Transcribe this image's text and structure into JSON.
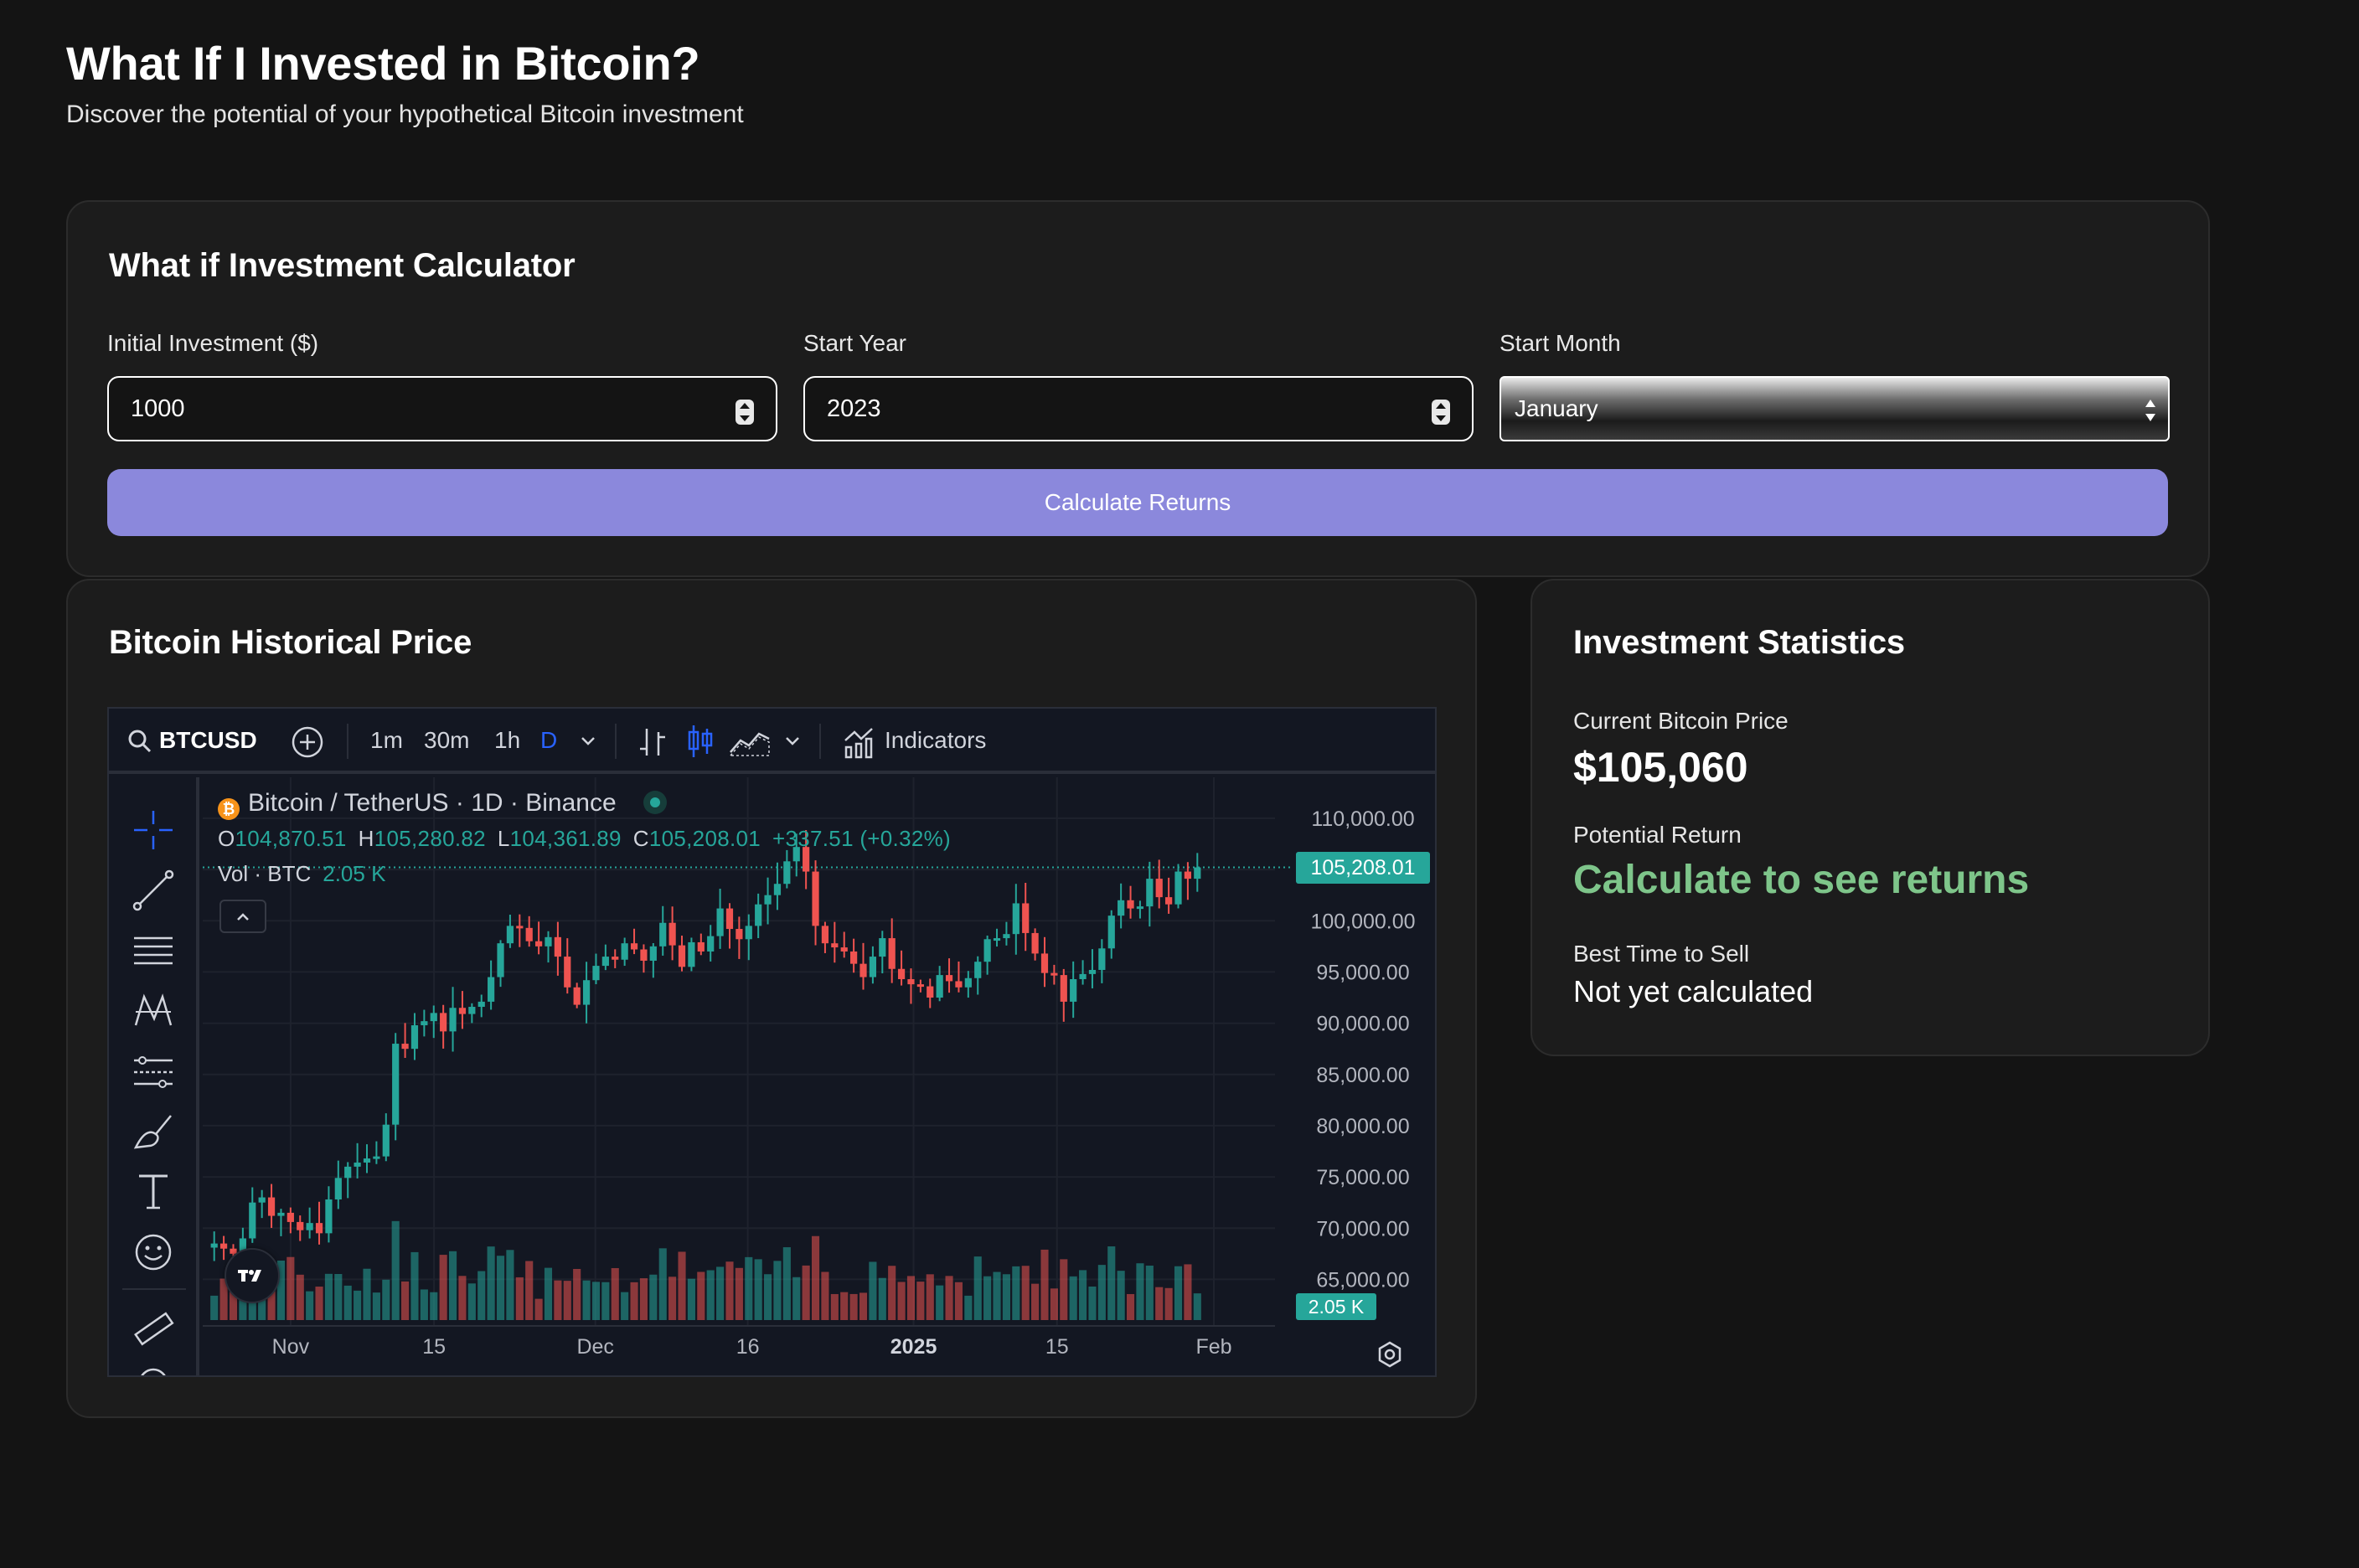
{
  "header": {
    "title": "What If I Invested in Bitcoin?",
    "subtitle": "Discover the potential of your hypothetical Bitcoin investment"
  },
  "calculator": {
    "title": "What if Investment Calculator",
    "fields": [
      {
        "label": "Initial Investment ($)",
        "value": "1000"
      },
      {
        "label": "Start Year",
        "value": "2023"
      },
      {
        "label": "Start Month",
        "value": "January"
      }
    ],
    "button": "Calculate Returns",
    "accent_color": "#8b88dc"
  },
  "chart_card": {
    "title": "Bitcoin Historical Price",
    "toolbar": {
      "symbol": "BTCUSD",
      "intervals": [
        "1m",
        "30m",
        "1h",
        "D"
      ],
      "active_interval": "D",
      "indicators_label": "Indicators"
    },
    "legend": {
      "pair": "Bitcoin / TetherUS · 1D · Binance",
      "o_label": "O",
      "o": "104,870.51",
      "h_label": "H",
      "h": "105,280.82",
      "l_label": "L",
      "l": "104,361.89",
      "c_label": "C",
      "c": "105,208.01",
      "change": "+337.51 (+0.32%)",
      "vol_label": "Vol · BTC",
      "vol": "2.05 K"
    },
    "price_tag": "105,208.01",
    "vol_tag": "2.05 K",
    "up_color": "#26a69a",
    "down_color": "#ef5350"
  },
  "chart_data": {
    "type": "candlestick",
    "symbol": "BTCUSD",
    "source": "Binance",
    "interval": "1D",
    "y_ticks": [
      "110,000.00",
      "105,000.00",
      "100,000.00",
      "95,000.00",
      "90,000.00",
      "85,000.00",
      "80,000.00",
      "75,000.00",
      "70,000.00",
      "65,000.00"
    ],
    "x_ticks": [
      "Nov",
      "15",
      "Dec",
      "16",
      "2025",
      "15",
      "Feb"
    ],
    "ylim": [
      62500,
      114000
    ],
    "close_series": [
      68500,
      68000,
      67500,
      69000,
      72500,
      73000,
      71200,
      71500,
      70600,
      69800,
      70500,
      69500,
      72800,
      74900,
      76000,
      76400,
      76800,
      77000,
      80100,
      88000,
      87500,
      89800,
      90200,
      91000,
      89200,
      91500,
      90900,
      91600,
      92100,
      94500,
      97800,
      99500,
      99300,
      98000,
      97500,
      98400,
      96500,
      93500,
      91800,
      94200,
      95600,
      96500,
      96200,
      97800,
      97200,
      96100,
      97500,
      99800,
      97600,
      95500,
      97900,
      97000,
      98500,
      101200,
      99200,
      98200,
      99500,
      101600,
      102500,
      103600,
      105800,
      107200,
      104800,
      99500,
      97800,
      97400,
      97000,
      95800,
      94500,
      96500,
      98300,
      95300,
      94300,
      93800,
      93600,
      92500,
      94700,
      94100,
      93500,
      94400,
      96000,
      98200,
      98300,
      98700,
      101700,
      98800,
      96800,
      94900,
      94700,
      92100,
      94300,
      94800,
      95200,
      97300,
      100500,
      102000,
      101200,
      101400,
      104100,
      102300,
      101600,
      104800,
      104100,
      105208
    ],
    "volume_note": "volume bars shown beneath price"
  },
  "stats": {
    "title": "Investment Statistics",
    "current_label": "Current Bitcoin Price",
    "current_value": "$105,060",
    "return_label": "Potential Return",
    "return_value": "Calculate to see returns",
    "best_label": "Best Time to Sell",
    "best_value": "Not yet calculated",
    "positive_color": "#7ec58a"
  }
}
